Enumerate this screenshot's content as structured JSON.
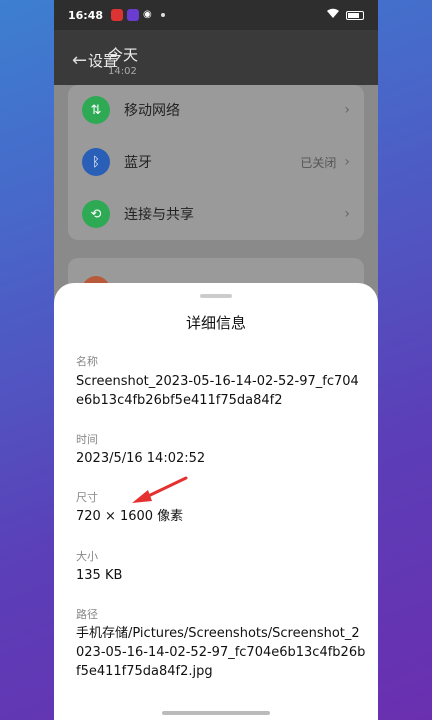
{
  "status_bar": {
    "time": "16:48"
  },
  "header": {
    "back_label": "设置",
    "title": "今天",
    "subtitle": "14:02"
  },
  "settings": [
    {
      "label": "移动网络",
      "value": "",
      "icon": "mobile-data-icon",
      "color": "#2eaa55"
    },
    {
      "label": "蓝牙",
      "value": "已关闭",
      "icon": "bluetooth-icon",
      "color": "#2a5fb8"
    },
    {
      "label": "连接与共享",
      "value": "",
      "icon": "share-icon",
      "color": "#2eaa55"
    }
  ],
  "sheet": {
    "title": "详细信息",
    "name_label": "名称",
    "name_value": "Screenshot_2023-05-16-14-02-52-97_fc704e6b13c4fb26bf5e411f75da84f2",
    "time_label": "时间",
    "time_value": "2023/5/16 14:02:52",
    "size_label": "尺寸",
    "size_value": "720 × 1600 像素",
    "filesize_label": "大小",
    "filesize_value": "135 KB",
    "path_label": "路径",
    "path_value": "手机存储/Pictures/Screenshots/Screenshot_2023-05-16-14-02-52-97_fc704e6b13c4fb26bf5e411f75da84f2.jpg"
  },
  "colors": {
    "annotation_arrow": "#e53030"
  }
}
